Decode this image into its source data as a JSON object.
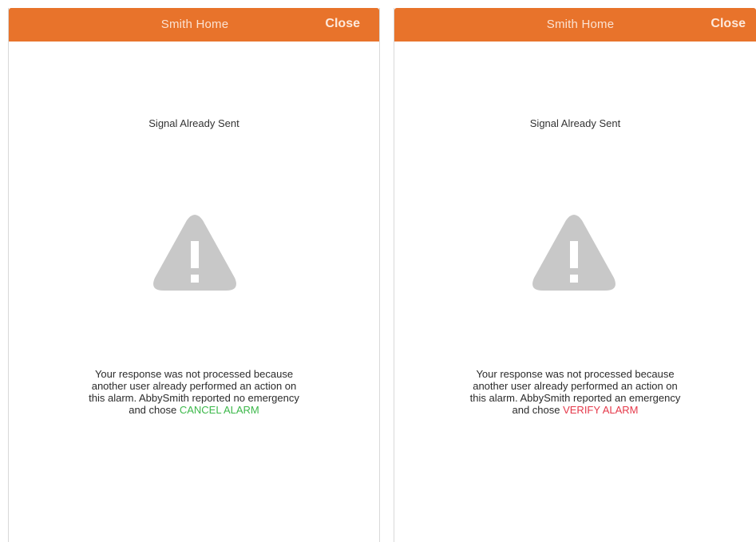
{
  "panels": [
    {
      "header": {
        "title": "Smith Home",
        "close_label": "Close"
      },
      "signal_title": "Signal Already Sent",
      "message": {
        "line1": "Your response was not processed because",
        "line2": "another user already performed an action on",
        "line3": "this alarm. AbbySmith reported no emergency",
        "line4_prefix": "and chose ",
        "action": "CANCEL ALARM"
      },
      "action_color": "#3cb84a",
      "icon": "warning-triangle-icon"
    },
    {
      "header": {
        "title": "Smith Home",
        "close_label": "Close"
      },
      "signal_title": "Signal Already Sent",
      "message": {
        "line1": "Your response was not processed because",
        "line2": "another user already performed an action on",
        "line3": "this alarm. AbbySmith reported an emergency",
        "line4_prefix": "and chose ",
        "action": "VERIFY ALARM"
      },
      "action_color": "#e5394a",
      "icon": "warning-triangle-icon"
    }
  ],
  "colors": {
    "header_bg": "#e8732b",
    "icon_gray": "#c8c8c8"
  }
}
